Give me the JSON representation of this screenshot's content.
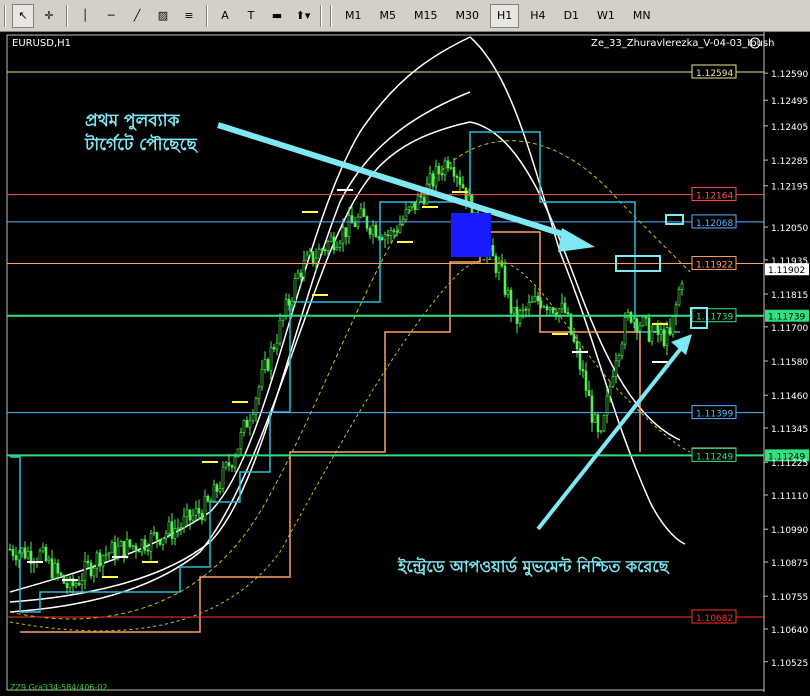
{
  "toolbar": {
    "tools": [
      {
        "name": "cursor-icon",
        "glyph": "↖"
      },
      {
        "name": "crosshair-icon",
        "glyph": "✛"
      },
      {
        "name": "vertical-line-icon",
        "glyph": "│"
      },
      {
        "name": "horizontal-line-icon",
        "glyph": "─"
      },
      {
        "name": "trendline-icon",
        "glyph": "╱"
      },
      {
        "name": "channel-icon",
        "glyph": "▨"
      },
      {
        "name": "fibonacci-icon",
        "glyph": "≡"
      },
      {
        "name": "text-icon",
        "glyph": "A"
      },
      {
        "name": "text-label-icon",
        "glyph": "T"
      },
      {
        "name": "rectangle-icon",
        "glyph": "▬"
      },
      {
        "name": "arrows-dropdown-icon",
        "glyph": "⬆▾"
      }
    ],
    "timeframes": [
      "M1",
      "M5",
      "M15",
      "M30",
      "H1",
      "H4",
      "D1",
      "W1",
      "MN"
    ],
    "active_timeframe": "H1"
  },
  "chart": {
    "symbol_label": "EURUSD,H1",
    "indicator_label": "Ze_33_Zhuravlerezka_V-04-03_Ibush",
    "bottom_label": "ZZ9 Gra334-584/406-02",
    "annotation_top": [
      "প্রথম পুলব্যাক",
      "টার্গেটে পৌছেছে"
    ],
    "annotation_bottom": "ইন্ট্রেডে আপওয়ার্ড মুভমেন্ট নিশ্চিত করেছে",
    "current_price": "1.11902",
    "scale_prices": [
      "1.12590",
      "1.12495",
      "1.12405",
      "1.12285",
      "1.12195",
      "1.12050",
      "1.11935",
      "1.11815",
      "1.11700",
      "1.11580",
      "1.11460",
      "1.11345",
      "1.11225",
      "1.11110",
      "1.10990",
      "1.10875",
      "1.10755",
      "1.10640",
      "1.10525"
    ],
    "levels": [
      {
        "price": "1.12594",
        "color": "#f0e68c"
      },
      {
        "price": "1.12164",
        "color": "#ff5050"
      },
      {
        "price": "1.12068",
        "color": "#5ab4ff"
      },
      {
        "price": "1.11922",
        "color": "#ffa060"
      },
      {
        "price": "1.11739",
        "color": "#30e080"
      },
      {
        "price": "1.11399",
        "color": "#5ab4ff"
      },
      {
        "price": "1.11250",
        "color": "#ffff60"
      },
      {
        "price": "1.11249",
        "color": "#30e080"
      },
      {
        "price": "1.10682",
        "color": "#ff3030"
      }
    ],
    "colors": {
      "candle": "#55ee55",
      "arrow": "#7ee8f5",
      "annotation": "#7ee8f5",
      "bb": "#ffffff",
      "channel_cyan": "#2bbcd6",
      "channel_orange": "#ffa060",
      "ma_yellow": "#c8c800"
    }
  }
}
